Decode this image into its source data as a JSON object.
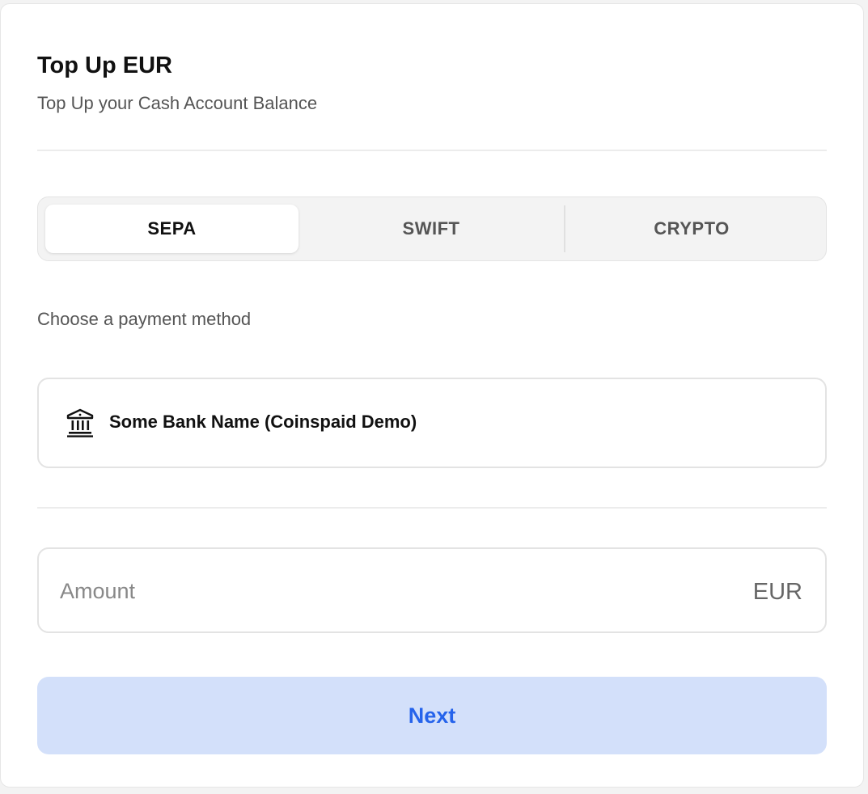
{
  "header": {
    "title": "Top Up EUR",
    "subtitle": "Top Up your Cash Account Balance"
  },
  "tabs": [
    {
      "label": "SEPA",
      "active": true
    },
    {
      "label": "SWIFT",
      "active": false
    },
    {
      "label": "CRYPTO",
      "active": false
    }
  ],
  "payment": {
    "section_label": "Choose a payment method",
    "methods": [
      {
        "icon": "bank-icon",
        "name": "Some Bank Name (Coinspaid Demo)"
      }
    ]
  },
  "amount": {
    "placeholder": "Amount",
    "value": "",
    "currency": "EUR"
  },
  "actions": {
    "next_label": "Next"
  },
  "colors": {
    "accent": "#2563eb",
    "button_bg": "#d3e0fa",
    "text_primary": "#111111",
    "text_secondary": "#555555"
  }
}
